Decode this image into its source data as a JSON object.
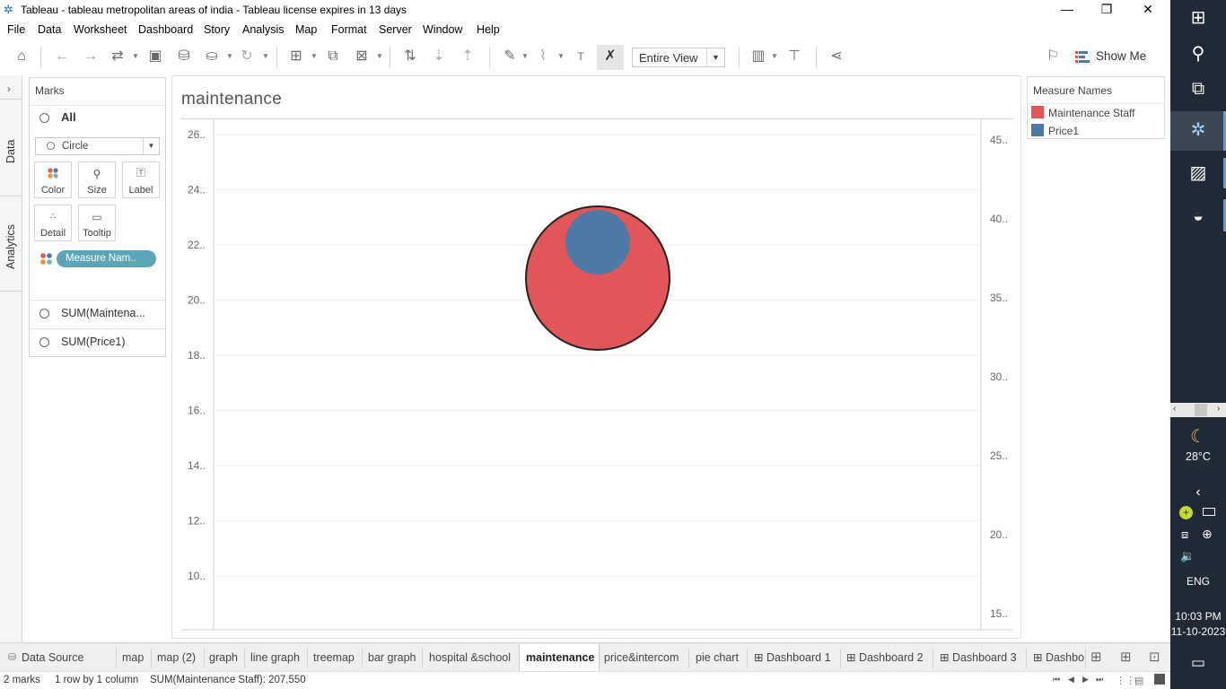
{
  "window": {
    "title": "Tableau - tableau metropolitan areas of india - Tableau license expires in 13 days",
    "minimize": "—",
    "maximize": "❐",
    "close": "✕"
  },
  "menu": [
    "File",
    "Data",
    "Worksheet",
    "Dashboard",
    "Story",
    "Analysis",
    "Map",
    "Format",
    "Server",
    "Window",
    "Help"
  ],
  "toolbar": {
    "view_mode": "Entire View",
    "show_me": "Show Me"
  },
  "side_tabs": {
    "data": "Data",
    "analytics": "Analytics"
  },
  "marks": {
    "header": "Marks",
    "all_label": "All",
    "mark_type": "Circle",
    "buttons": {
      "color": "Color",
      "size": "Size",
      "label": "Label",
      "detail": "Detail",
      "tooltip": "Tooltip"
    },
    "pill": "Measure Nam..",
    "rows": [
      "SUM(Maintena...",
      "SUM(Price1)"
    ]
  },
  "sheet": {
    "title": "maintenance"
  },
  "chart_data": {
    "type": "scatter",
    "title": "maintenance",
    "left_axis": {
      "ticks": [
        "26..",
        "24..",
        "22..",
        "20..",
        "18..",
        "16..",
        "14..",
        "12..",
        "10.."
      ]
    },
    "right_axis": {
      "ticks": [
        "45..",
        "40..",
        "35..",
        "30..",
        "25..",
        "20..",
        "15.."
      ]
    },
    "series": [
      {
        "name": "Maintenance Staff",
        "color": "#e15759",
        "value": 207550
      },
      {
        "name": "Price1",
        "color": "#4e79a7"
      }
    ],
    "grid": true
  },
  "legend": {
    "title": "Measure Names",
    "items": [
      {
        "label": "Maintenance Staff",
        "color": "#e15759"
      },
      {
        "label": "Price1",
        "color": "#4e79a7"
      }
    ]
  },
  "tabs": {
    "data_source": "Data Source",
    "sheets": [
      "map",
      "map (2)",
      "graph",
      "line graph",
      "treemap",
      "bar graph",
      "hospital &school",
      "maintenance",
      "price&intercom",
      "pie chart"
    ],
    "dashboards": [
      "Dashboard 1",
      "Dashboard 2",
      "Dashboard 3",
      "Dashbo"
    ],
    "active": "maintenance"
  },
  "status": {
    "marks": "2 marks",
    "rows": "1 row by 1 column",
    "sum": "SUM(Maintenance Staff): 207,550"
  },
  "taskbar": {
    "weather": "28°C",
    "language": "ENG",
    "time": "10:03 PM",
    "date": "11-10-2023"
  }
}
